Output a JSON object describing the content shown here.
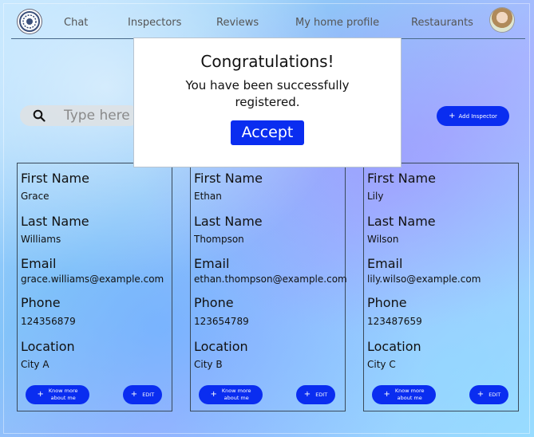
{
  "nav": {
    "items": [
      "Chat",
      "Inspectors",
      "Reviews",
      "My home profile",
      "Restaurants"
    ]
  },
  "search": {
    "placeholder": "Type here t"
  },
  "add_inspector": {
    "label": "Add Inspector"
  },
  "modal": {
    "title": "Congratulations!",
    "message": "You have been successfully registered.",
    "accept_label": "Accept"
  },
  "field_labels": {
    "first_name": "First Name",
    "last_name": "Last Name",
    "email": "Email",
    "phone": "Phone",
    "location": "Location"
  },
  "inspectors": [
    {
      "first_name": "Grace",
      "last_name": "Williams",
      "email": "grace.williams@example.com",
      "phone": "124356879",
      "location": "City A"
    },
    {
      "first_name": "Ethan",
      "last_name": "Thompson",
      "email": "ethan.thompson@example.com",
      "phone": "123654789",
      "location": "City B"
    },
    {
      "first_name": "Lily",
      "last_name": "Wilson",
      "email": "lily.wilso@example.com",
      "phone": "123487659",
      "location": "City C"
    }
  ],
  "card_buttons": {
    "know_more_line1": "Know more",
    "know_more_line2": "about me",
    "edit": "EDIT"
  },
  "icons": {
    "plus": "+",
    "search": "search-icon"
  },
  "colors": {
    "accent": "#0a2df0"
  }
}
